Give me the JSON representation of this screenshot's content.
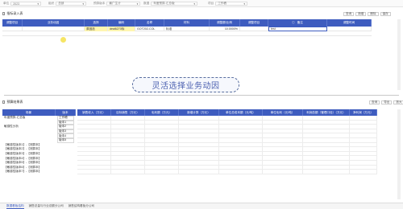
{
  "filterbar": {
    "filters": [
      {
        "label": "单位",
        "value": "2023"
      },
      {
        "label": "组织",
        "value": "总部"
      },
      {
        "label": "预算版本",
        "value": "最广生计"
      },
      {
        "label": "数据",
        "value": "年度预算-汇总版"
      },
      {
        "label": "项目",
        "value": "工作稿"
      }
    ]
  },
  "top_section": {
    "title": "指标录入表",
    "toolbar": [
      "查询",
      "新增",
      "删除",
      "保存"
    ]
  },
  "grid1": {
    "columns": [
      "调整项目",
      "业务动因",
      "选择",
      "编码",
      "名称",
      "材料",
      "调整额/比例",
      "调整项目",
      "备注",
      "调整时间"
    ],
    "row": {
      "c2": "原因选",
      "c3": "deal6270标",
      "c4": "GOT202-COL",
      "c5": "标准",
      "c6": "10.0000%",
      "c8": "test"
    }
  },
  "banner": {
    "text": "灵活选择业务动因"
  },
  "bottom_section": {
    "title": "预算结果表",
    "toolbar": [
      "查询",
      "导出",
      "放大"
    ]
  },
  "grid2": {
    "left_columns": [
      "场景",
      "版本"
    ],
    "right_columns": [
      "销售收入（万元）",
      "目标销售（万元）",
      "毛利额（万元）",
      "新增计算（万元）",
      "单位总成本额（元/吨）",
      "单位毛利（元/吨）",
      "利润总额（管理口径）（万元）",
      "净利润（万元）"
    ],
    "rows": [
      {
        "scene": "年度预算-汇总版",
        "version": "工作稿"
      },
      {
        "scene": "",
        "version": "版本1"
      },
      {
        "scene": "敏感性分析",
        "version": "版本2"
      },
      {
        "scene": "",
        "version": "版本3"
      },
      {
        "scene": "",
        "version": "版本4"
      },
      {
        "scene": "",
        "version": "版本5"
      },
      {
        "scene": "【敏感性版本1】-【测算本】",
        "version": ""
      },
      {
        "scene": "【敏感性版本2】-【测算本】",
        "version": ""
      },
      {
        "scene": "【敏感性版本3】-【测算本】",
        "version": ""
      },
      {
        "scene": "【敏感性版本4】-【测算本】",
        "version": ""
      },
      {
        "scene": "【敏感性版本5】-【测算本】",
        "version": ""
      },
      {
        "scene": "【敏感性版本6】-【测算本】",
        "version": ""
      },
      {
        "scene": "【敏感性版本7】-【测算本】",
        "version": ""
      }
    ]
  },
  "bottom_tabs": [
    "数据看板结构",
    "销售总量与行业总额分公司",
    "销售结构看板分公司"
  ]
}
